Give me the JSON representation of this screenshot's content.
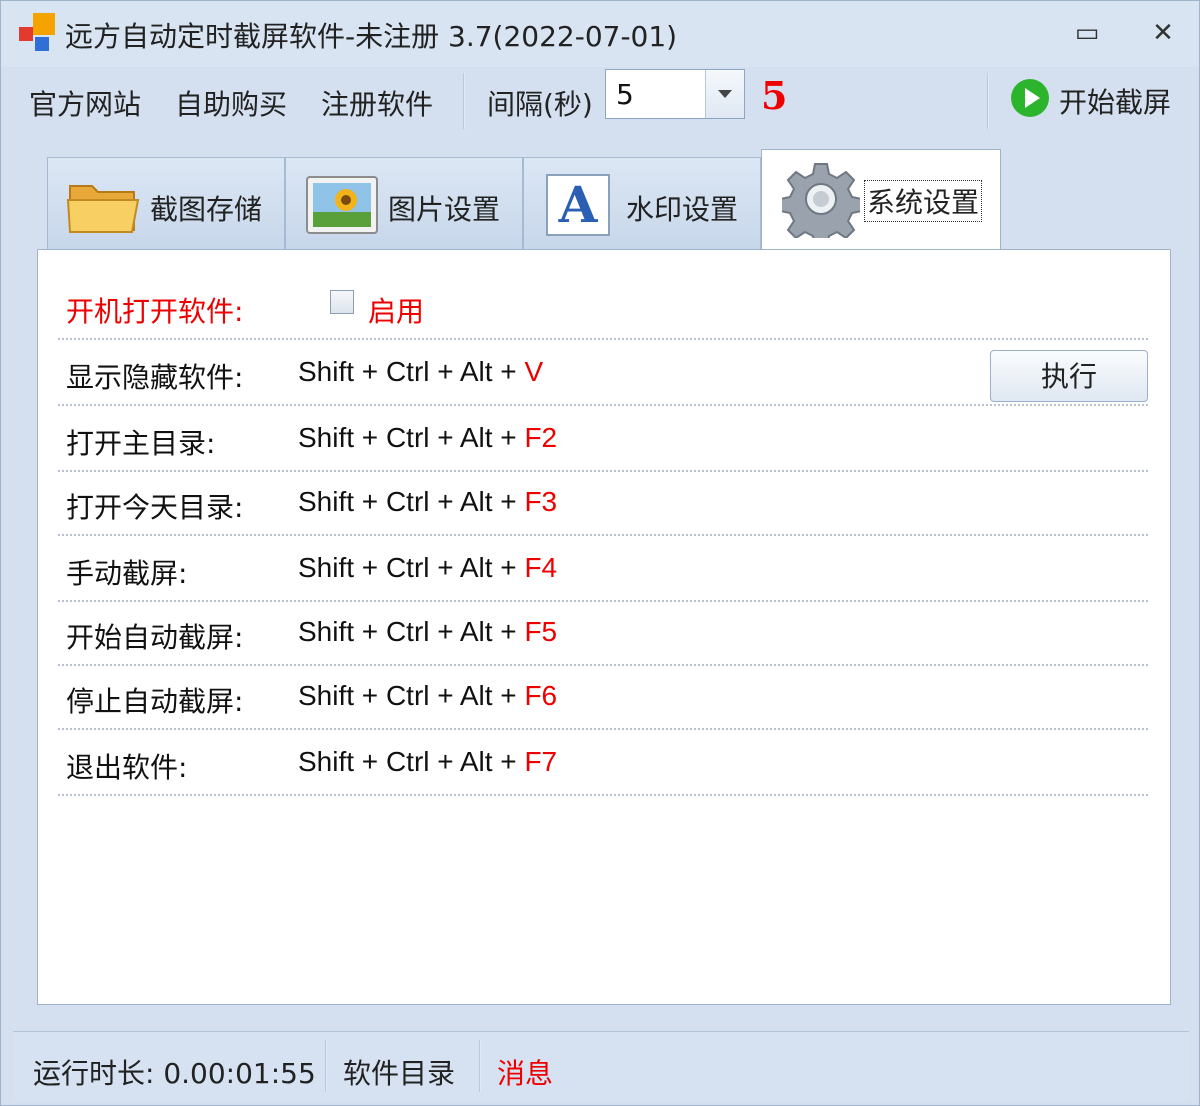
{
  "window": {
    "title": "远方自动定时截屏软件-未注册 3.7(2022-07-01)",
    "minimize_glyph": "▭",
    "close_glyph": "✕"
  },
  "toolbar": {
    "official_site": "官方网站",
    "self_purchase": "自助购买",
    "register": "注册软件",
    "interval_label": "间隔(秒)",
    "interval_value": "5",
    "interval_display": "5",
    "start_label": "开始截屏"
  },
  "tabs": [
    {
      "label": "截图存储",
      "icon": "folder-icon"
    },
    {
      "label": "图片设置",
      "icon": "picture-icon"
    },
    {
      "label": "水印设置",
      "icon": "letter-a-icon",
      "glyph": "A"
    },
    {
      "label": "系统设置",
      "icon": "gear-icon",
      "active": true
    }
  ],
  "settings": {
    "autostart_label": "开机打开软件:",
    "autostart_option": "启用",
    "autostart_checked": false,
    "execute_button": "执行",
    "hotkeys": [
      {
        "label": "显示隐藏软件:",
        "combo": "Shift + Ctrl + Alt + ",
        "key": "V"
      },
      {
        "label": "打开主目录:",
        "combo": "Shift + Ctrl + Alt + ",
        "key": "F2"
      },
      {
        "label": "打开今天目录:",
        "combo": "Shift + Ctrl + Alt + ",
        "key": "F3"
      },
      {
        "label": "手动截屏:",
        "combo": "Shift + Ctrl + Alt + ",
        "key": "F4"
      },
      {
        "label": "开始自动截屏:",
        "combo": "Shift + Ctrl + Alt + ",
        "key": "F5"
      },
      {
        "label": "停止自动截屏:",
        "combo": "Shift + Ctrl + Alt + ",
        "key": "F6"
      },
      {
        "label": "退出软件:",
        "combo": "Shift + Ctrl + Alt + ",
        "key": "F7"
      }
    ]
  },
  "status": {
    "runtime": "运行时长: 0.00:01:55",
    "software_dir": "软件目录",
    "message": "消息"
  },
  "colors": {
    "accent_red": "#ee0000",
    "window_bg": "#d4e0ef",
    "play_green": "#2cb52c"
  }
}
